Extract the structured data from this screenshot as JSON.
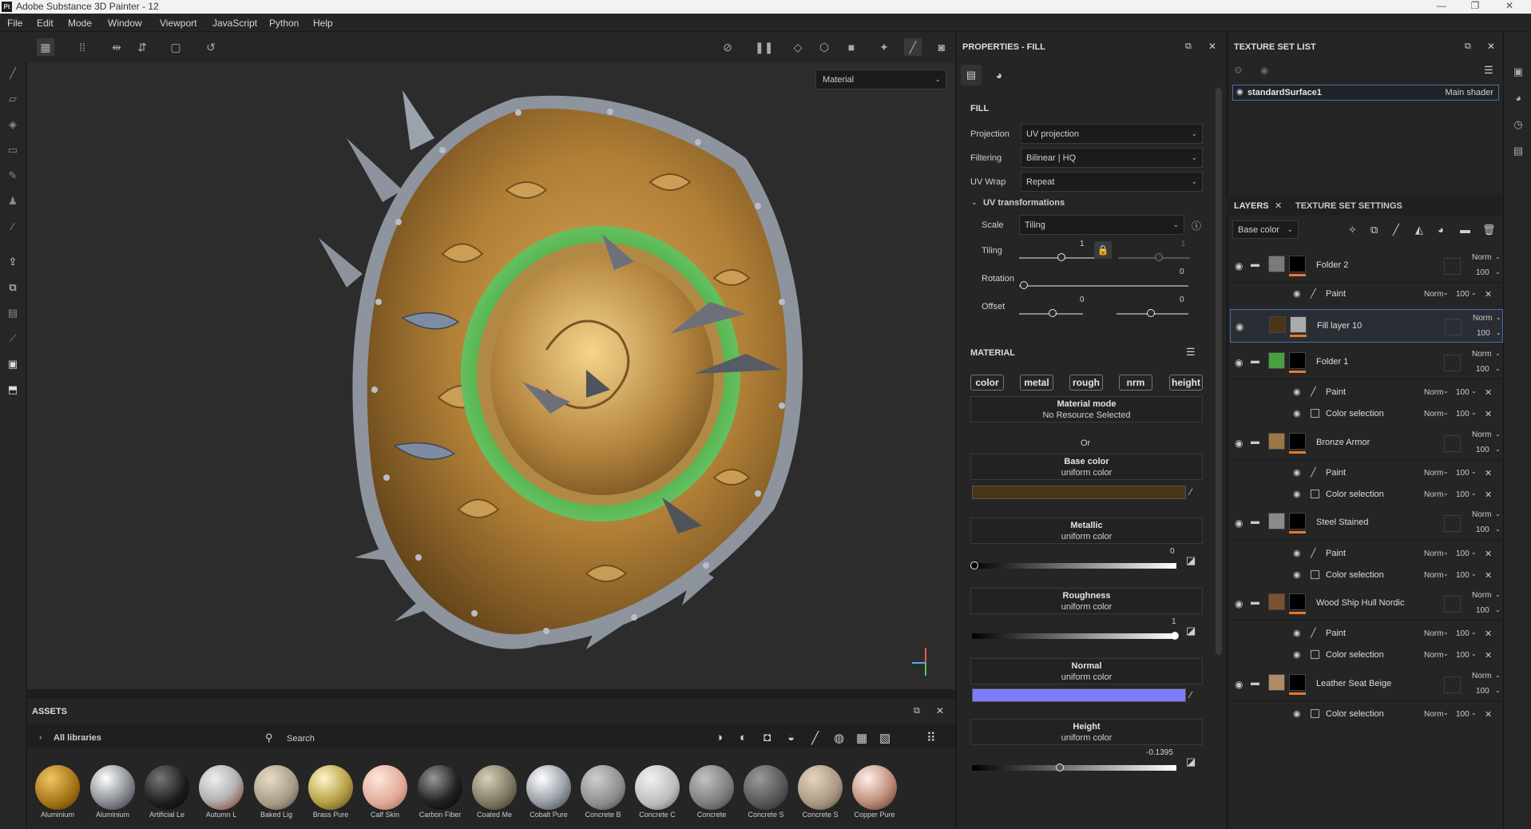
{
  "app": {
    "title": "Adobe Substance 3D Painter - 12",
    "logo": "Pt"
  },
  "menu": [
    "File",
    "Edit",
    "Mode",
    "Window",
    "Viewport",
    "JavaScript",
    "Python",
    "Help"
  ],
  "viewport": {
    "material_dropdown": "Material"
  },
  "properties": {
    "title": "PROPERTIES - FILL",
    "section_fill": "FILL",
    "projection_label": "Projection",
    "projection_value": "UV projection",
    "filtering_label": "Filtering",
    "filtering_value": "Bilinear | HQ",
    "uvwrap_label": "UV Wrap",
    "uvwrap_value": "Repeat",
    "uvtrans_label": "UV transformations",
    "scale_label": "Scale",
    "scale_value": "Tiling",
    "tiling_label": "Tiling",
    "tiling_a": "1",
    "tiling_b": "1",
    "rotation_label": "Rotation",
    "rotation_value": "0",
    "offset_label": "Offset",
    "offset_a": "0",
    "offset_b": "0",
    "section_material": "MATERIAL",
    "chips": [
      "color",
      "metal",
      "rough",
      "nrm",
      "height"
    ],
    "material_mode_title": "Material mode",
    "material_mode_value": "No Resource Selected",
    "or": "Or",
    "base_color_title": "Base color",
    "base_color_sub": "uniform color",
    "base_color_hex": "#4a3516",
    "metallic_title": "Metallic",
    "metallic_sub": "uniform color",
    "metallic_value": "0",
    "roughness_title": "Roughness",
    "roughness_sub": "uniform color",
    "roughness_value": "1",
    "normal_title": "Normal",
    "normal_sub": "uniform color",
    "normal_hex": "#7d7dfc",
    "height_title": "Height",
    "height_sub": "uniform color",
    "height_value": "-0.1395"
  },
  "texture_set": {
    "title": "TEXTURE SET LIST",
    "item_name": "standardSurface1",
    "item_shader": "Main shader"
  },
  "layers_panel": {
    "tab_layers": "LAYERS",
    "tab_settings": "TEXTURE SET SETTINGS",
    "channel": "Base color",
    "layers": [
      {
        "name": "Folder 2",
        "mode": "Norm",
        "opacity": "100"
      },
      {
        "name": "Fill layer 10",
        "mode": "Norm",
        "opacity": "100"
      },
      {
        "name": "Folder 1",
        "mode": "Norm",
        "opacity": "100"
      },
      {
        "name": "Bronze Armor",
        "mode": "Norm",
        "opacity": "100"
      },
      {
        "name": "Steel Stained",
        "mode": "Norm",
        "opacity": "100"
      },
      {
        "name": "Wood Ship Hull Nordic",
        "mode": "Norm",
        "opacity": "100"
      },
      {
        "name": "Leather Seat Beige",
        "mode": "Norm",
        "opacity": "100"
      }
    ],
    "sub_paint": "Paint",
    "sub_colorsel": "Color selection",
    "sub_mode": "Norm",
    "sub_opacity": "100"
  },
  "assets": {
    "title": "ASSETS",
    "all_libraries": "All libraries",
    "search_placeholder": "Search",
    "items": [
      "Aluminium",
      "Aluminium",
      "Artificial Le",
      "Autumn L",
      "Baked Lig",
      "Brass Pure",
      "Calf Skin",
      "Carbon Fiber",
      "Coated Me",
      "Cobalt Pure",
      "Concrete B",
      "Concrete C",
      "Concrete",
      "Concrete S",
      "Concrete S",
      "Copper Pure"
    ]
  }
}
